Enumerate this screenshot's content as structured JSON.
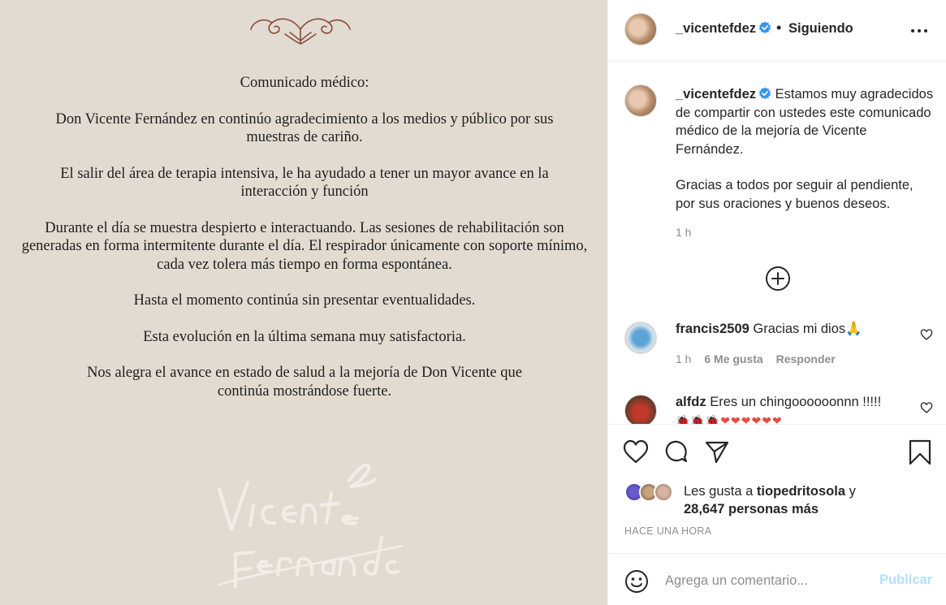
{
  "post": {
    "statement": {
      "title": "Comunicado médico:",
      "paragraphs": [
        "Don Vicente Fernández en continúo agradecimiento a los medios y público por sus muestras de cariño.",
        "El salir del área de terapia intensiva, le ha ayudado a tener un mayor avance en la interacción y función",
        "Durante el día se muestra despierto e interactuando. Las sesiones de rehabilitación son generadas en forma intermitente durante el día. El respirador únicamente con soporte mínimo, cada vez tolera más tiempo en forma espontánea.",
        "Hasta el momento continúa sin presentar eventualidades.",
        "Esta evolución en la última semana muy satisfactoria.",
        "Nos alegra el avance en estado de salud a la mejoría de Don Vicente que continúa mostrándose fuerte."
      ],
      "signature": "Vicente Fernández"
    },
    "header": {
      "username": "_vicentefdez",
      "separator": "•",
      "follow_status": "Siguiendo"
    },
    "caption": {
      "username": "_vicentefdez",
      "text_1": "Estamos muy agradecidos de compartir con ustedes este comunicado médico de la mejoría de Vicente Fernández.",
      "text_2": "Gracias a todos por seguir al pendiente, por sus oraciones y buenos deseos.",
      "time": "1 h"
    },
    "comments": [
      {
        "username": "francis2509",
        "text": "Gracias mi dios🙏",
        "time": "1 h",
        "likes": "6 Me gusta",
        "reply": "Responder"
      },
      {
        "username": "alfdz",
        "text": "Eres un chingoooooonnn !!!!!",
        "emoji_line": "🐞🐞🐞❤❤❤❤❤❤"
      }
    ],
    "likes": {
      "prefix": "Les gusta a",
      "user": "tiopedritosola",
      "conjunction": "y",
      "count": "28,647 personas más"
    },
    "timestamp": "HACE UNA HORA",
    "composer": {
      "placeholder": "Agrega un comentario...",
      "publish_label": "Publicar"
    },
    "colors": {
      "verified": "#3897f0",
      "muted": "#8e8e8e",
      "publish_disabled": "#b2dffc",
      "media_bg": "#e2dbd1"
    },
    "icons": [
      "more-options-icon",
      "verified-icon",
      "load-more-icon",
      "heart-icon",
      "comment-icon",
      "share-icon",
      "bookmark-icon",
      "emoji-icon"
    ]
  }
}
